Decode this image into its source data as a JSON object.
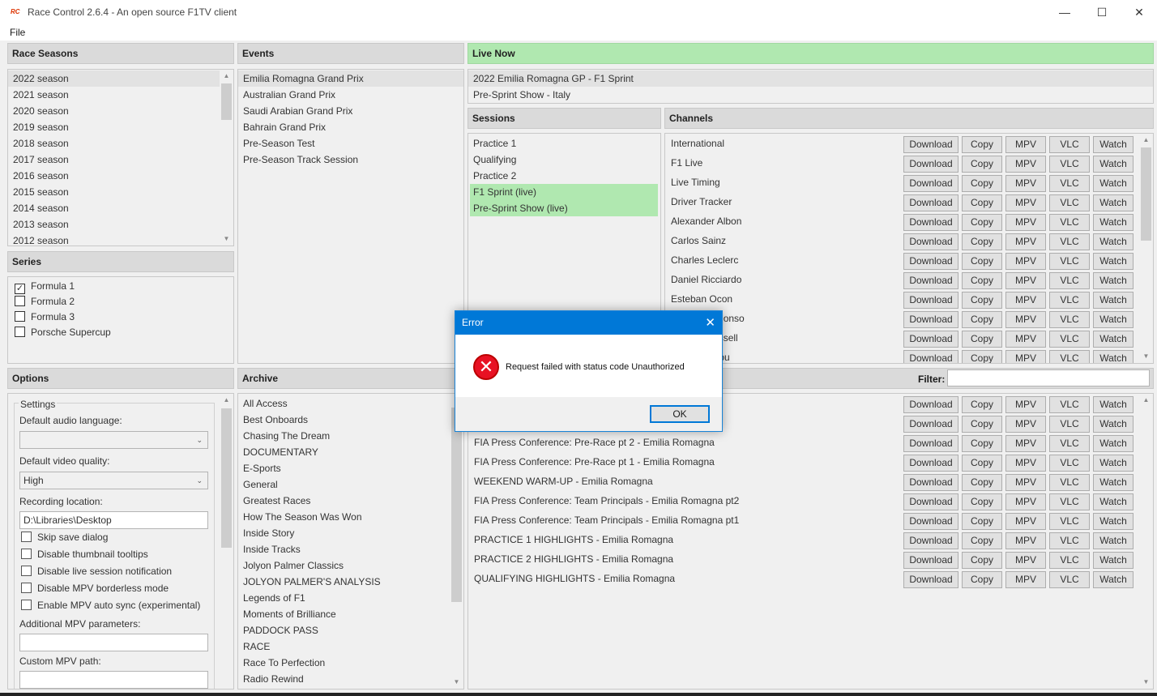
{
  "window": {
    "logo": "RC",
    "title": "Race Control 2.6.4 - An open source F1TV client",
    "minimize": "—",
    "maximize": "☐",
    "close": "✕"
  },
  "menu": {
    "file": "File"
  },
  "race_seasons": {
    "header": "Race Seasons",
    "items": [
      "2022 season",
      "2021 season",
      "2020 season",
      "2019 season",
      "2018 season",
      "2017 season",
      "2016 season",
      "2015 season",
      "2014 season",
      "2013 season",
      "2012 season"
    ]
  },
  "events": {
    "header": "Events",
    "items": [
      "Emilia Romagna Grand Prix",
      "Australian Grand Prix",
      "Saudi Arabian Grand Prix",
      "Bahrain Grand Prix",
      "Pre-Season Test",
      "Pre-Season Track Session"
    ]
  },
  "live_now": {
    "header": "Live Now",
    "items": [
      "2022 Emilia Romagna GP - F1 Sprint",
      "Pre-Sprint Show - Italy"
    ]
  },
  "series": {
    "header": "Series",
    "items": [
      {
        "label": "Formula 1",
        "checked": true
      },
      {
        "label": "Formula 2",
        "checked": false
      },
      {
        "label": "Formula 3",
        "checked": false
      },
      {
        "label": "Porsche Supercup",
        "checked": false
      }
    ]
  },
  "sessions": {
    "header": "Sessions",
    "items": [
      {
        "label": "Practice 1",
        "live": false
      },
      {
        "label": "Qualifying",
        "live": false
      },
      {
        "label": "Practice 2",
        "live": false
      },
      {
        "label": "F1 Sprint (live)",
        "live": true
      },
      {
        "label": "Pre-Sprint Show (live)",
        "live": true
      }
    ]
  },
  "actions": {
    "download": "Download",
    "copy": "Copy",
    "mpv": "MPV",
    "vlc": "VLC",
    "watch": "Watch"
  },
  "channels": {
    "header": "Channels",
    "items": [
      "International",
      "F1 Live",
      "Live Timing",
      "Driver Tracker",
      "Alexander Albon",
      "Carlos Sainz",
      "Charles Leclerc",
      "Daniel Ricciardo",
      "Esteban Ocon",
      "Fernando Alonso",
      "George Russell",
      "Guanyu Zhou"
    ]
  },
  "options": {
    "header": "Options",
    "settings_group": "Settings",
    "audio_label": "Default audio language:",
    "audio_value": "",
    "quality_label": "Default video quality:",
    "quality_value": "High",
    "recording_label": "Recording location:",
    "recording_value": "D:\\Libraries\\Desktop",
    "checkboxes": [
      "Skip save dialog",
      "Disable thumbnail tooltips",
      "Disable live session notification",
      "Disable MPV borderless mode",
      "Enable MPV auto sync (experimental)"
    ],
    "mpv_params_label": "Additional MPV parameters:",
    "mpv_params_value": "",
    "mpv_path_label": "Custom MPV path:",
    "mpv_path_value": ""
  },
  "archive": {
    "header": "Archive",
    "items": [
      "All Access",
      "Best Onboards",
      "Chasing The Dream",
      "DOCUMENTARY",
      "E-Sports",
      "General",
      "Greatest Races",
      "How The Season Was Won",
      "Inside Story",
      "Inside Tracks",
      "Jolyon Palmer Classics",
      "JOLYON PALMER'S ANALYSIS",
      "Legends of F1",
      "Moments of Brilliance",
      "PADDOCK PASS",
      "RACE",
      "Race To Perfection",
      "Radio Rewind"
    ]
  },
  "episodes": {
    "filter_label": "Filter:",
    "filter_value": "",
    "items": [
      "",
      "",
      "FIA Press Conference: Pre-Race pt 2 - Emilia Romagna",
      "FIA Press Conference: Pre-Race pt 1 - Emilia Romagna",
      "WEEKEND WARM-UP - Emilia Romagna",
      "FIA Press Conference: Team Principals - Emilia Romagna pt2",
      "FIA Press Conference: Team Principals - Emilia Romagna pt1",
      "PRACTICE 1 HIGHLIGHTS - Emilia Romagna",
      "PRACTICE 2 HIGHLIGHTS - Emilia Romagna",
      "QUALIFYING HIGHLIGHTS - Emilia Romagna"
    ]
  },
  "dialog": {
    "title": "Error",
    "close": "✕",
    "icon": "✕",
    "message": "Request failed with status code Unauthorized",
    "ok": "OK"
  }
}
